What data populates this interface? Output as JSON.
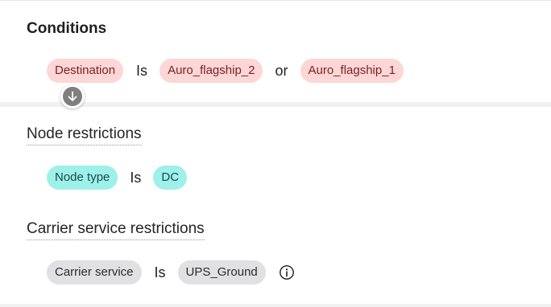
{
  "conditions": {
    "title": "Conditions",
    "attribute": "Destination",
    "operator": "Is",
    "values": [
      "Auro_flagship_2",
      "Auro_flagship_1"
    ],
    "joiner": "or",
    "move_down_icon": "arrow-down-circle-icon"
  },
  "node_restrictions": {
    "title": "Node restrictions",
    "attribute": "Node type",
    "operator": "Is",
    "value": "DC"
  },
  "carrier_restrictions": {
    "title": "Carrier service restrictions",
    "attribute": "Carrier service",
    "operator": "Is",
    "value": "UPS_Ground",
    "info_icon": "info-icon"
  },
  "colors": {
    "destination_pill": "#fdd6d6",
    "node_pill": "#9ef0ea",
    "carrier_pill": "#e1e1e3",
    "divider": "#f1f1f1"
  }
}
